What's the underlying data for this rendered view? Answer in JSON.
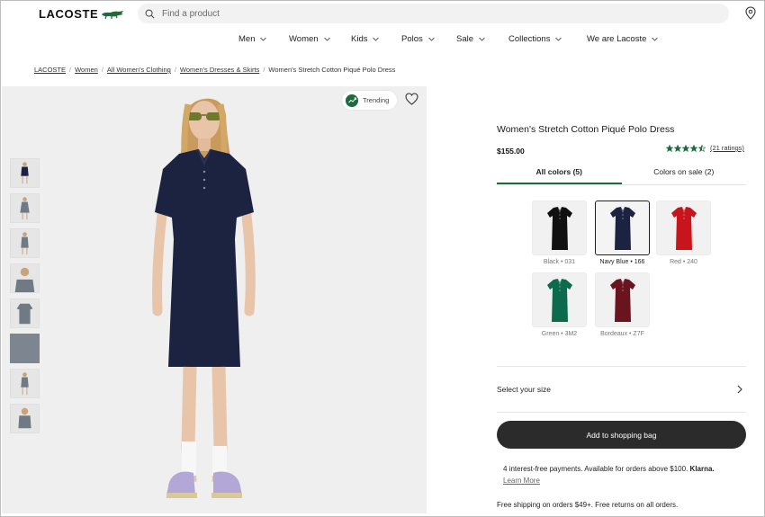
{
  "header": {
    "logo_text": "LACOSTE",
    "search_placeholder": "Find a product"
  },
  "nav": {
    "items": [
      {
        "label": "Men"
      },
      {
        "label": "Women"
      },
      {
        "label": "Kids"
      },
      {
        "label": "Polos"
      },
      {
        "label": "Sale"
      },
      {
        "label": "Collections"
      },
      {
        "label": "We are Lacoste"
      }
    ]
  },
  "breadcrumb": {
    "items": [
      "LACOSTE",
      "Women",
      "All Women's Clothing",
      "Women's Dresses & Skirts"
    ],
    "current": "Women's Stretch Cotton Piqué Polo Dress"
  },
  "gallery": {
    "trending_label": "Trending",
    "thumbnail_count": 8,
    "active_thumbnail": 6
  },
  "product": {
    "title": "Women's Stretch Cotton Piqué Polo Dress",
    "price": "$155.00",
    "rating": 4.5,
    "rating_max": 5,
    "ratings_label": "(21 ratings)"
  },
  "color_tabs": [
    {
      "label": "All colors (5)",
      "active": true
    },
    {
      "label": "Colors on sale (2)",
      "active": false
    }
  ],
  "colors": [
    {
      "label": "Black • 031",
      "hex": "#111111",
      "selected": false
    },
    {
      "label": "Navy Blue • 166",
      "hex": "#1c2340",
      "selected": true
    },
    {
      "label": "Red • 240",
      "hex": "#c8141c",
      "selected": false
    },
    {
      "label": "Green • 3M2",
      "hex": "#0b6b4c",
      "selected": false
    },
    {
      "label": "Bordeaux • Z7F",
      "hex": "#6a1420",
      "selected": false
    }
  ],
  "size": {
    "label": "Select your size"
  },
  "cta": {
    "add_to_bag": "Add to shopping bag"
  },
  "payments": {
    "text": "4 interest-free payments. Available for orders above $100.",
    "brand": "Klarna.",
    "learn_more": "Learn More"
  },
  "shipping": {
    "text": "Free shipping on orders $49+. Free returns on all orders."
  },
  "colors_theme": {
    "accent_green": "#1d6a3f",
    "button_dark": "#2b2b2b"
  }
}
